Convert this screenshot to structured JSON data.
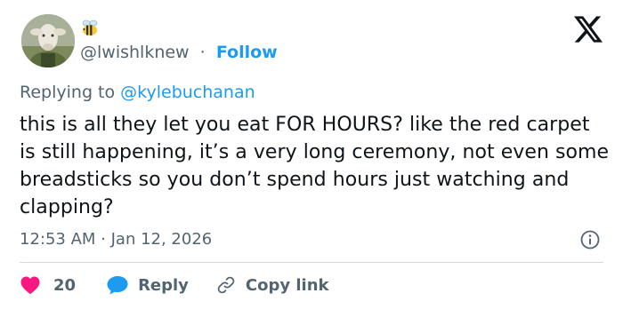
{
  "author": {
    "handle": "@lwishlknew",
    "separator": "·",
    "follow_label": "Follow",
    "avatar_icon": "sheep-avatar",
    "badge_icon": "bee-emoji"
  },
  "reply_context": {
    "prefix": "Replying to ",
    "mention": "@kylebuchanan"
  },
  "tweet": {
    "text": "this is all they let you eat FOR HOURS? like the red carpet is still happening, it’s a very long ceremony, not even some breadsticks so you don’t spend hours just watching and clapping?",
    "timestamp": "12:53 AM · Jan 12, 2026"
  },
  "actions": {
    "like_count": "20",
    "reply_label": "Reply",
    "copy_link_label": "Copy link"
  },
  "colors": {
    "accent": "#1d9bf0",
    "like": "#f91880",
    "secondary_text": "#536471",
    "divider": "#cfd9de"
  }
}
